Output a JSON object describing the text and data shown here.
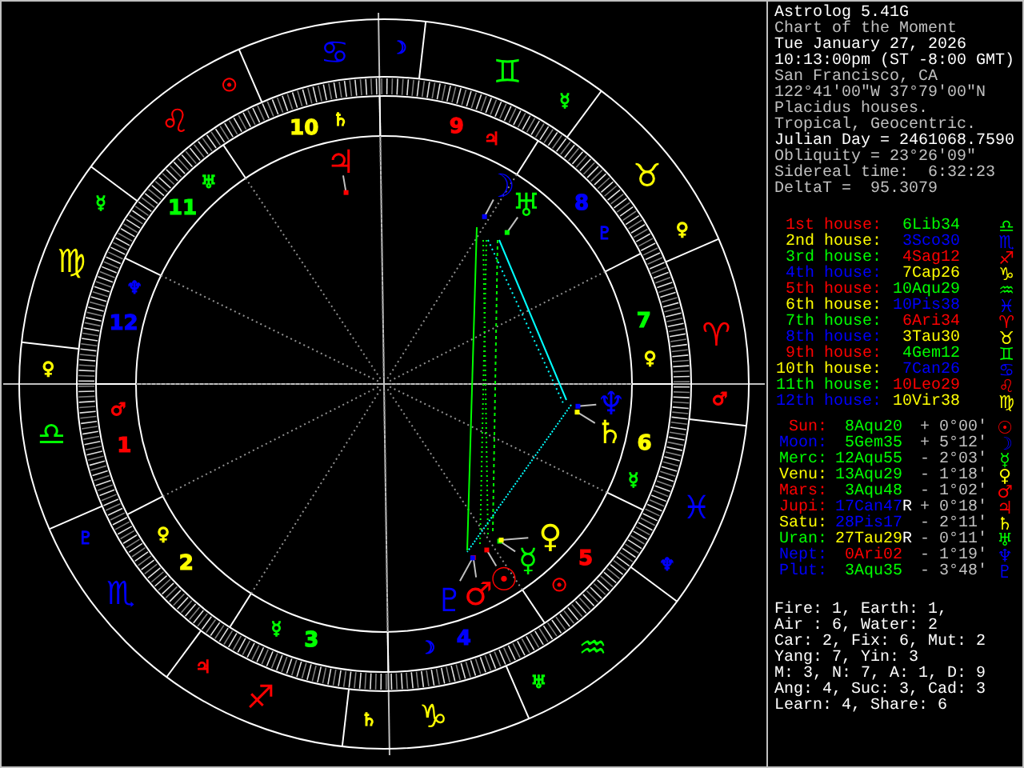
{
  "chart": {
    "signs": [
      {
        "glyph": "♈",
        "color": "#ff0000",
        "ruler": {
          "glyph": "♂",
          "color": "#ff0000"
        }
      },
      {
        "glyph": "♉",
        "color": "#ffff00",
        "ruler": {
          "glyph": "♀",
          "color": "#ffff00"
        }
      },
      {
        "glyph": "♊",
        "color": "#00ff00",
        "ruler": {
          "glyph": "☿",
          "color": "#00ff00"
        }
      },
      {
        "glyph": "♋",
        "color": "#0000ff",
        "ruler": {
          "glyph": "☽",
          "color": "#0000ff"
        }
      },
      {
        "glyph": "♌",
        "color": "#ff0000",
        "ruler": {
          "glyph": "☉",
          "color": "#ff0000"
        }
      },
      {
        "glyph": "♍",
        "color": "#ffff00",
        "ruler": {
          "glyph": "☿",
          "color": "#00ff00"
        }
      },
      {
        "glyph": "♎",
        "color": "#00ff00",
        "ruler": {
          "glyph": "♀",
          "color": "#ffff00"
        }
      },
      {
        "glyph": "♏",
        "color": "#0000ff",
        "ruler": {
          "glyph": "♇",
          "color": "#0000ff"
        }
      },
      {
        "glyph": "♐",
        "color": "#ff0000",
        "ruler": {
          "glyph": "♃",
          "color": "#ff0000"
        }
      },
      {
        "glyph": "♑",
        "color": "#ffff00",
        "ruler": {
          "glyph": "♄",
          "color": "#ffff00"
        }
      },
      {
        "glyph": "♒",
        "color": "#00ff00",
        "ruler": {
          "glyph": "♅",
          "color": "#00ff00"
        }
      },
      {
        "glyph": "♓",
        "color": "#0000ff",
        "ruler": {
          "glyph": "♆",
          "color": "#0000ff"
        }
      }
    ],
    "houses": [
      {
        "number": "1",
        "color": "#ff0000",
        "ruler": {
          "glyph": "♂",
          "color": "#ff0000"
        }
      },
      {
        "number": "2",
        "color": "#ffff00",
        "ruler": {
          "glyph": "♀",
          "color": "#ffff00"
        }
      },
      {
        "number": "3",
        "color": "#00ff00",
        "ruler": {
          "glyph": "☿",
          "color": "#00ff00"
        }
      },
      {
        "number": "4",
        "color": "#0000ff",
        "ruler": {
          "glyph": "☽",
          "color": "#0000ff"
        }
      },
      {
        "number": "5",
        "color": "#ff0000",
        "ruler": {
          "glyph": "☉",
          "color": "#ff0000"
        }
      },
      {
        "number": "6",
        "color": "#ffff00",
        "ruler": {
          "glyph": "☿",
          "color": "#00ff00"
        }
      },
      {
        "number": "7",
        "color": "#00ff00",
        "ruler": {
          "glyph": "♀",
          "color": "#ffff00"
        }
      },
      {
        "number": "8",
        "color": "#0000ff",
        "ruler": {
          "glyph": "♇",
          "color": "#0000ff"
        }
      },
      {
        "number": "9",
        "color": "#ff0000",
        "ruler": {
          "glyph": "♃",
          "color": "#ff0000"
        }
      },
      {
        "number": "10",
        "color": "#ffff00",
        "ruler": {
          "glyph": "♄",
          "color": "#ffff00"
        }
      },
      {
        "number": "11",
        "color": "#00ff00",
        "ruler": {
          "glyph": "♅",
          "color": "#00ff00"
        }
      },
      {
        "number": "12",
        "color": "#0000ff",
        "ruler": {
          "glyph": "♆",
          "color": "#0000ff"
        }
      }
    ],
    "planets": [
      {
        "glyph": "☉",
        "color": "#ff0000"
      },
      {
        "glyph": "☽",
        "color": "#0000ff"
      },
      {
        "glyph": "☿",
        "color": "#00ff00"
      },
      {
        "glyph": "♀",
        "color": "#ffff00"
      },
      {
        "glyph": "♂",
        "color": "#ff0000"
      },
      {
        "glyph": "♃",
        "color": "#ff0000"
      },
      {
        "glyph": "♄",
        "color": "#ffff00"
      },
      {
        "glyph": "♅",
        "color": "#00ff00"
      },
      {
        "glyph": "♆",
        "color": "#0000ff"
      },
      {
        "glyph": "♇",
        "color": "#0000ff"
      }
    ]
  },
  "info": [
    {
      "text": "Astrolog 5.41G",
      "bright": true
    },
    {
      "text": "Chart of the Moment",
      "bright": false
    },
    {
      "text": "Tue January 27, 2026",
      "bright": true
    },
    {
      "text": "10:13:00pm (ST -8:00 GMT)",
      "bright": true
    },
    {
      "text": "San Francisco, CA",
      "bright": false
    },
    {
      "text": "122°41'00\"W 37°79'00\"N",
      "bright": false
    },
    {
      "text": "Placidus houses.",
      "bright": false
    },
    {
      "text": "Tropical, Geocentric.",
      "bright": false
    },
    {
      "text": "Julian Day = 2461068.7590",
      "bright": true
    },
    {
      "text": "Obliquity = 23°26'09\"",
      "bright": false
    },
    {
      "text": "Sidereal time:  6:32:23",
      "bright": false
    },
    {
      "text": "DeltaT =  95.3079",
      "bright": false
    }
  ],
  "houses": [
    {
      "label": "1st house:",
      "color": "#ff0000",
      "sign": {
        "position": "6Lib34",
        "glyph": "♎",
        "color": "#00ff00"
      }
    },
    {
      "label": "2nd house:",
      "color": "#ffff00",
      "sign": {
        "position": "3Sco30",
        "glyph": "♏",
        "color": "#0000ff"
      }
    },
    {
      "label": "3rd house:",
      "color": "#00ff00",
      "sign": {
        "position": "4Sag12",
        "glyph": "♐",
        "color": "#ff0000"
      }
    },
    {
      "label": "4th house:",
      "color": "#0000ff",
      "sign": {
        "position": "7Cap26",
        "glyph": "♑",
        "color": "#ffff00"
      }
    },
    {
      "label": "5th house:",
      "color": "#ff0000",
      "sign": {
        "position": "10Aqu29",
        "glyph": "♒",
        "color": "#00ff00"
      }
    },
    {
      "label": "6th house:",
      "color": "#ffff00",
      "sign": {
        "position": "10Pis38",
        "glyph": "♓",
        "color": "#0000ff"
      }
    },
    {
      "label": "7th house:",
      "color": "#00ff00",
      "sign": {
        "position": "6Ari34",
        "glyph": "♈",
        "color": "#ff0000"
      }
    },
    {
      "label": "8th house:",
      "color": "#0000ff",
      "sign": {
        "position": "3Tau30",
        "glyph": "♉",
        "color": "#ffff00"
      }
    },
    {
      "label": "9th house:",
      "color": "#ff0000",
      "sign": {
        "position": "4Gem12",
        "glyph": "♊",
        "color": "#00ff00"
      }
    },
    {
      "label": "10th house:",
      "color": "#ffff00",
      "sign": {
        "position": "7Can26",
        "glyph": "♋",
        "color": "#0000ff"
      }
    },
    {
      "label": "11th house:",
      "color": "#00ff00",
      "sign": {
        "position": "10Leo29",
        "glyph": "♌",
        "color": "#ff0000"
      }
    },
    {
      "label": "12th house:",
      "color": "#0000ff",
      "sign": {
        "position": "10Vir38",
        "glyph": "♍",
        "color": "#ffff00"
      }
    }
  ],
  "planets": [
    {
      "name": "Sun:",
      "color": "#ff0000",
      "glyph": "☉",
      "latitude": "+ 0°00'",
      "sign": {
        "position": "8Aqu20",
        "color": "#00ff00"
      }
    },
    {
      "name": "Moon:",
      "color": "#0000ff",
      "glyph": "☽",
      "latitude": "+ 5°12'",
      "sign": {
        "position": "5Gem35",
        "color": "#00ff00"
      }
    },
    {
      "name": "Merc:",
      "color": "#00ff00",
      "glyph": "☿",
      "latitude": "- 2°03'",
      "sign": {
        "position": "12Aqu55",
        "color": "#00ff00"
      }
    },
    {
      "name": "Venu:",
      "color": "#ffff00",
      "glyph": "♀",
      "latitude": "- 1°18'",
      "sign": {
        "position": "13Aqu29",
        "color": "#00ff00"
      }
    },
    {
      "name": "Mars:",
      "color": "#ff0000",
      "glyph": "♂",
      "latitude": "- 1°02'",
      "sign": {
        "position": "3Aqu48",
        "color": "#00ff00"
      }
    },
    {
      "name": "Jupi:",
      "color": "#ff0000",
      "glyph": "♃",
      "retrograde": "R",
      "latitude": "+ 0°18'",
      "sign": {
        "position": "17Can47",
        "color": "#0000ff"
      }
    },
    {
      "name": "Satu:",
      "color": "#ffff00",
      "glyph": "♄",
      "latitude": "- 2°11'",
      "sign": {
        "position": "28Pis17",
        "color": "#0000ff"
      }
    },
    {
      "name": "Uran:",
      "color": "#00ff00",
      "glyph": "♅",
      "retrograde": "R",
      "latitude": "- 0°11'",
      "sign": {
        "position": "27Tau29",
        "color": "#ffff00"
      }
    },
    {
      "name": "Nept:",
      "color": "#0000ff",
      "glyph": "♆",
      "latitude": "- 1°19'",
      "sign": {
        "position": "0Ari02",
        "color": "#ff0000"
      }
    },
    {
      "name": "Plut:",
      "color": "#0000ff",
      "glyph": "♇",
      "latitude": "- 3°48'",
      "sign": {
        "position": "3Aqu35",
        "color": "#00ff00"
      }
    }
  ],
  "summary": [
    "Fire: 1, Earth: 1,",
    "Air : 6, Water: 2",
    "Car: 2, Fix: 6, Mut: 2",
    "Yang: 7, Yin: 3",
    "M: 3, N: 7, A: 1, D: 9",
    "Ang: 4, Suc: 3, Cad: 3",
    "Learn: 4, Share: 6"
  ]
}
